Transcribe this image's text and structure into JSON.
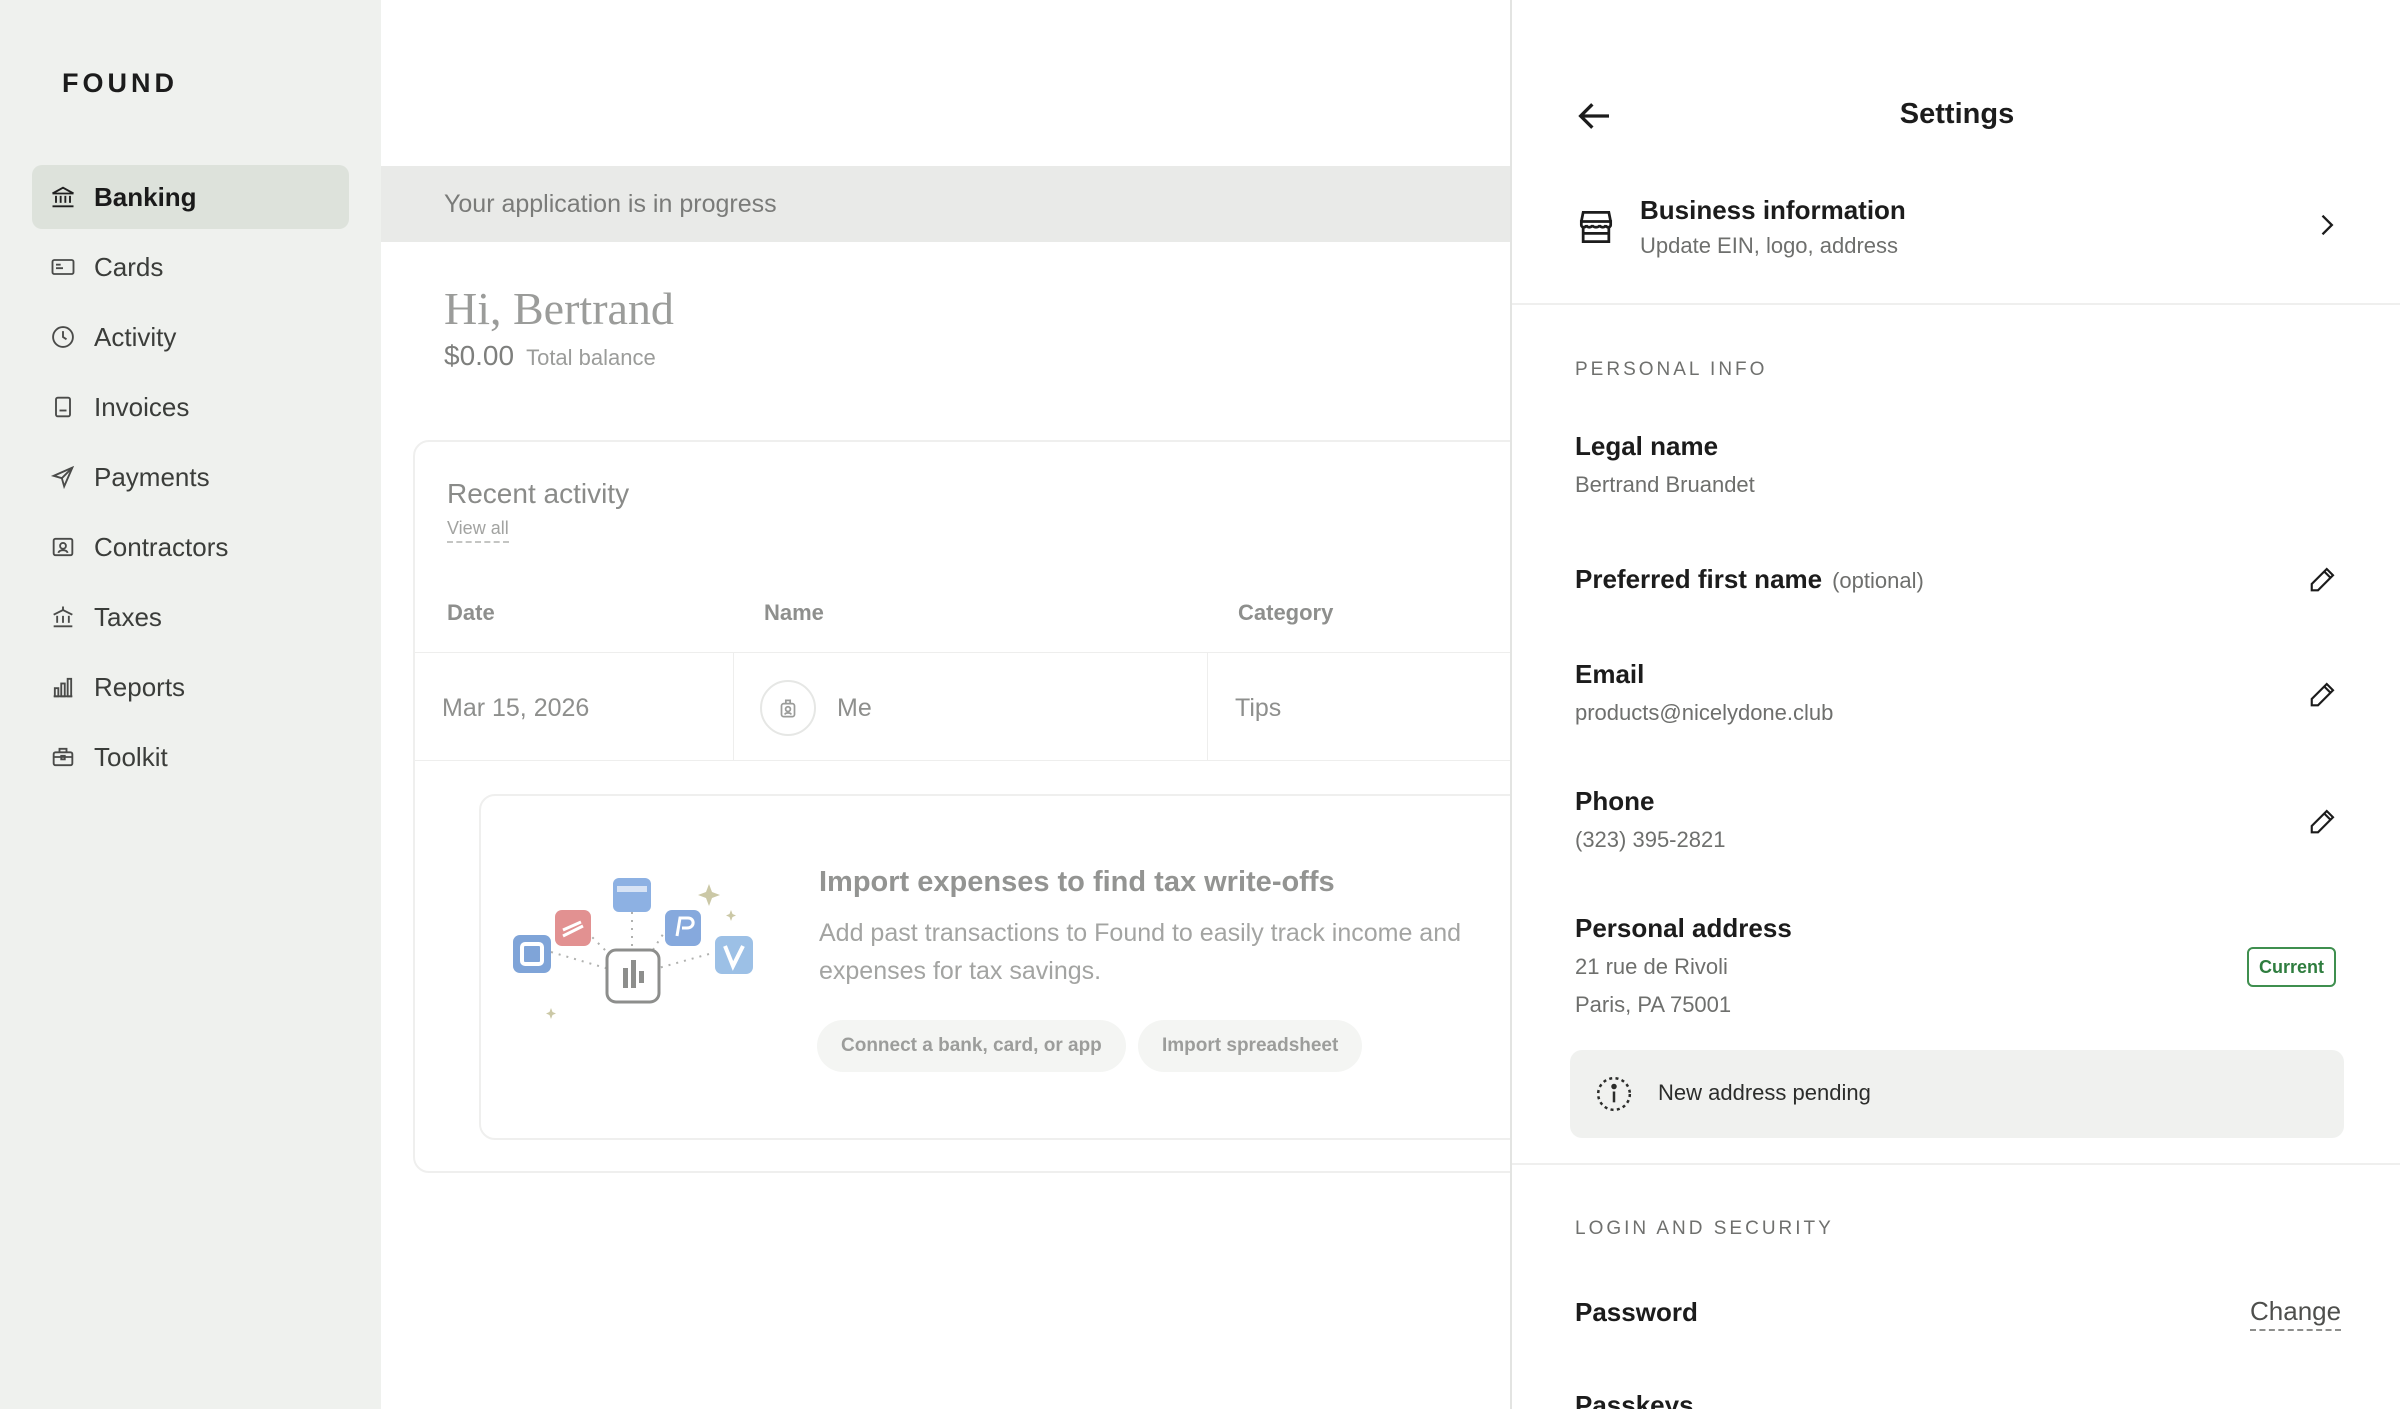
{
  "sidebar": {
    "logo": "FOUND",
    "items": [
      {
        "label": "Banking",
        "icon": "bank-icon",
        "active": true
      },
      {
        "label": "Cards",
        "icon": "card-icon"
      },
      {
        "label": "Activity",
        "icon": "clock-icon"
      },
      {
        "label": "Invoices",
        "icon": "invoice-icon"
      },
      {
        "label": "Payments",
        "icon": "send-icon"
      },
      {
        "label": "Contractors",
        "icon": "contractor-icon"
      },
      {
        "label": "Taxes",
        "icon": "government-icon"
      },
      {
        "label": "Reports",
        "icon": "bar-chart-icon"
      },
      {
        "label": "Toolkit",
        "icon": "briefcase-icon"
      }
    ]
  },
  "main": {
    "banner": "Your application is in progress",
    "greeting": "Hi, Bertrand",
    "balance_amount": "$0.00",
    "balance_label": "Total balance",
    "activity": {
      "title": "Recent activity",
      "view_all": "View all",
      "columns": [
        "Date",
        "Name",
        "Category"
      ],
      "rows": [
        {
          "date": "Mar 15, 2026",
          "name": "Me",
          "category": "Tips"
        }
      ]
    },
    "import": {
      "title": "Import expenses to find tax write-offs",
      "description": "Add past transactions to Found to easily track income and expenses for tax savings.",
      "connect_button": "Connect a bank, card, or app",
      "spreadsheet_button": "Import spreadsheet"
    }
  },
  "settings": {
    "title": "Settings",
    "business": {
      "title": "Business information",
      "subtitle": "Update EIN, logo, address"
    },
    "personal_section": "PERSONAL INFO",
    "legal_name_label": "Legal name",
    "legal_name_value": "Bertrand Bruandet",
    "preferred_name_label": "Preferred first name",
    "preferred_name_optional": "(optional)",
    "email_label": "Email",
    "email_value": "products@nicelydone.club",
    "phone_label": "Phone",
    "phone_value": "(323) 395-2821",
    "address_label": "Personal address",
    "address_line1": "21 rue de Rivoli",
    "address_line2": "Paris, PA 75001",
    "address_badge": "Current",
    "pending_notice": "New address pending",
    "security_section": "LOGIN AND SECURITY",
    "password_label": "Password",
    "password_action": "Change",
    "passkeys_label": "Passkeys"
  },
  "colors": {
    "sidebar_bg": "#eff1ee",
    "active_item_bg": "#dde2db",
    "badge_green": "#2f7d3f"
  }
}
